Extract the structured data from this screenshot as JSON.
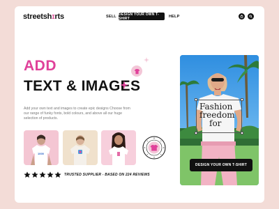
{
  "nav": {
    "logo_prefix": "streetsh",
    "logo_accent": "i",
    "logo_suffix": "rts",
    "sell_label": "SELL",
    "cta_label": "DESIGN YOUR OWN T-SHIRT",
    "help_label": "HELP"
  },
  "hero": {
    "title_accent": "ADD",
    "title_main": "TEXT & IMAGES",
    "description": "Add your own text and images to create epic designs Choose from our range of funky fonts, bold colours, and above all our huge selection of products.",
    "cta_label": "DESIGN YOUR OWN T-SHIRT",
    "shirt_text": [
      "Fashion",
      "freedom",
      "for"
    ]
  },
  "products": [
    {
      "shirt_print": "1000"
    },
    {
      "shirt_print": ""
    },
    {
      "shirt_print": ""
    }
  ],
  "trust": {
    "rating_stars": 5,
    "text": "TRUSTED SUPPLIER - BASED ON  224  REVIEWS"
  },
  "colors": {
    "accent_pink": "#e0419a",
    "background": "#f3dcd7",
    "dark": "#111111"
  },
  "icons": [
    "bag-icon",
    "search-icon",
    "sparkle-icon",
    "shirt-badge-icon",
    "seal-icon",
    "star-icon"
  ]
}
